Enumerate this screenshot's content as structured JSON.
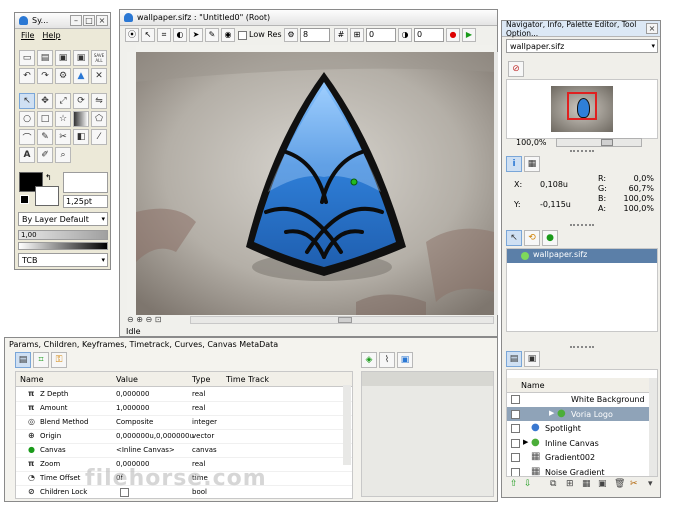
{
  "toolbox": {
    "title": "Sy...",
    "menu": [
      "File",
      "Help"
    ],
    "save_all": "SAVE ALL",
    "width_value": "1,25pt",
    "blend_mode": "By Layer Default",
    "opacity": "1,00",
    "interp": "TCB"
  },
  "canvas_window": {
    "title": "wallpaper.sifz : \"Untitled0\" (Root)",
    "low_res_label": "Low Res",
    "fields": [
      "8",
      "0",
      "0"
    ],
    "status": "Idle"
  },
  "params_panel": {
    "title": "Params, Children, Keyframes, Timetrack, Curves, Canvas MetaData",
    "columns": [
      "Name",
      "Value",
      "Type",
      "Time Track"
    ],
    "rows": [
      {
        "name": "Z Depth",
        "value": "0,000000",
        "type": "real",
        "icon": "pi-icon"
      },
      {
        "name": "Amount",
        "value": "1,000000",
        "type": "real",
        "icon": "pi-icon"
      },
      {
        "name": "Blend Method",
        "value": "Composite",
        "type": "integer",
        "icon": "blend-icon"
      },
      {
        "name": "Origin",
        "value": "0,000000u,0,000000u",
        "type": "vector",
        "icon": "origin-icon"
      },
      {
        "name": "Canvas",
        "value": "<Inline Canvas>",
        "type": "canvas",
        "icon": "canvas-icon"
      },
      {
        "name": "Zoom",
        "value": "0,000000",
        "type": "real",
        "icon": "pi-icon"
      },
      {
        "name": "Time Offset",
        "value": "0f",
        "type": "time",
        "icon": "clock-icon"
      },
      {
        "name": "Children Lock",
        "value": "",
        "type": "bool",
        "icon": "lock-icon"
      }
    ],
    "watermark": "filehorse.com"
  },
  "navigator": {
    "title": "Navigator, Info, Palette Editor, Tool Option...",
    "file": "wallpaper.sifz",
    "zoom": "100,0%"
  },
  "info": {
    "x_label": "X:",
    "x": "0,108u",
    "y_label": "Y:",
    "y": "-0,115u",
    "r_label": "R:",
    "r": "0,0%",
    "g_label": "G:",
    "g": "60,7%",
    "b_label": "B:",
    "b": "100,0%",
    "a_label": "A:",
    "a": "100,0%"
  },
  "canvas_browser": {
    "file": "wallpaper.sifz"
  },
  "layers": {
    "column": "Name",
    "items": [
      {
        "name": "White Background",
        "indent": 1,
        "check": true,
        "selected": false,
        "icon": "rectangle-icon"
      },
      {
        "name": "Voria Logo",
        "indent": 1,
        "check": true,
        "selected": true,
        "icon": "group-icon"
      },
      {
        "name": "Spotlight",
        "indent": 0,
        "check": true,
        "selected": false,
        "icon": "circle-icon"
      },
      {
        "name": "Inline Canvas",
        "indent": 0,
        "check": true,
        "selected": false,
        "icon": "group-icon"
      },
      {
        "name": "Gradient002",
        "indent": 0,
        "check": true,
        "selected": false,
        "icon": "gradient-icon"
      },
      {
        "name": "Noise Gradient",
        "indent": 0,
        "check": true,
        "selected": false,
        "icon": "gradient-icon"
      }
    ]
  },
  "colors": {
    "accent": "#3a8ee6",
    "selection": "#5b7fa8",
    "layer_selected": "#8fa3b8",
    "logo_blue": "#2f7fd8"
  }
}
